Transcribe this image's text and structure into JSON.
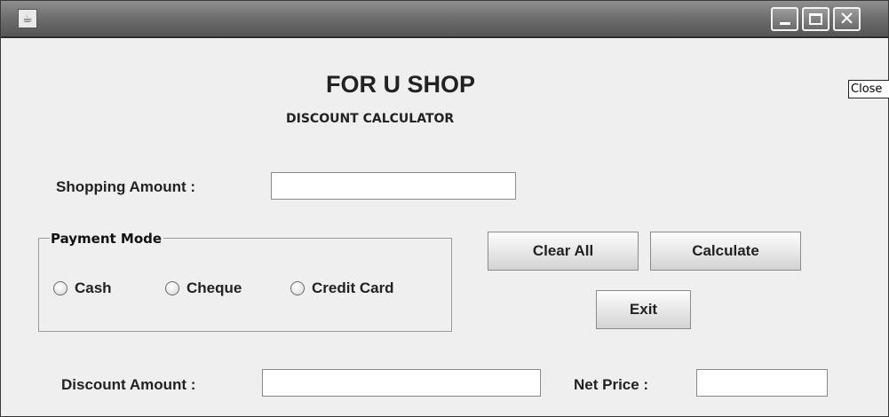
{
  "window": {
    "icon": "java-cup-icon",
    "controls": [
      "minimize-icon",
      "maximize-icon",
      "close-icon"
    ],
    "close_symbol": "✕"
  },
  "tooltip": {
    "text": "Close"
  },
  "header": {
    "title": "FOR U SHOP",
    "subtitle": "DISCOUNT CALCULATOR"
  },
  "form": {
    "shopping_amount_label": "Shopping Amount :",
    "shopping_amount_value": "",
    "discount_amount_label": "Discount Amount :",
    "discount_amount_value": "",
    "net_price_label": "Net Price :",
    "net_price_value": ""
  },
  "payment_mode": {
    "title": "Payment Mode",
    "options": [
      "Cash",
      "Cheque",
      "Credit Card"
    ],
    "selected": null
  },
  "buttons": {
    "clear_all": "Clear All",
    "calculate": "Calculate",
    "exit": "Exit"
  }
}
